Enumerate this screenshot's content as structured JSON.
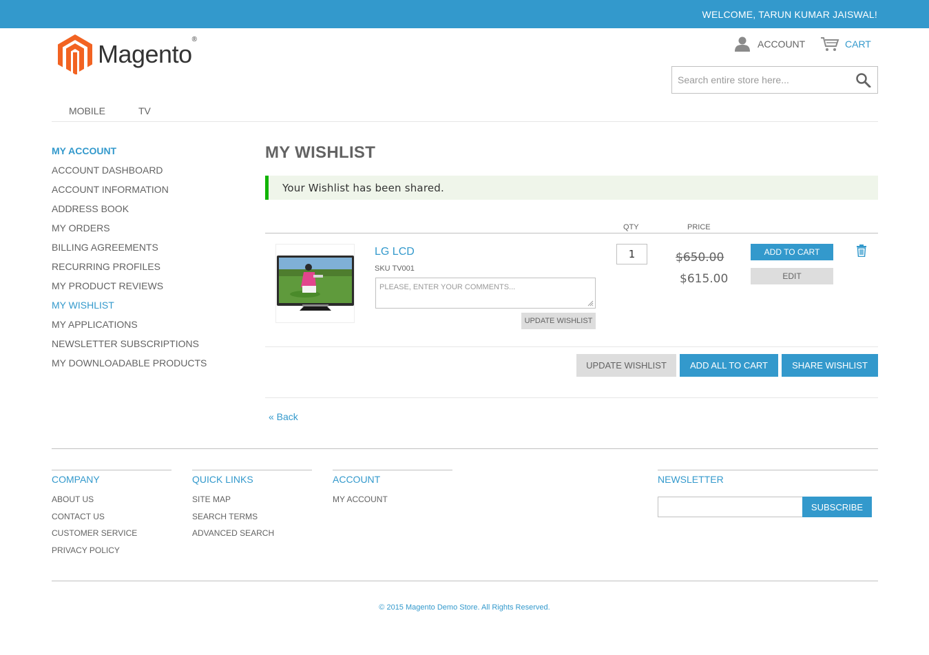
{
  "header": {
    "welcome": "WELCOME, TARUN KUMAR JAISWAL!",
    "logo_text": "Magento",
    "logo_mark": "®",
    "account_label": "ACCOUNT",
    "cart_label": "CART",
    "search_placeholder": "Search entire store here..."
  },
  "nav": {
    "items": [
      "MOBILE",
      "TV"
    ]
  },
  "sidebar": {
    "title": "MY ACCOUNT",
    "items": [
      "ACCOUNT DASHBOARD",
      "ACCOUNT INFORMATION",
      "ADDRESS BOOK",
      "MY ORDERS",
      "BILLING AGREEMENTS",
      "RECURRING PROFILES",
      "MY PRODUCT REVIEWS",
      "MY WISHLIST",
      "MY APPLICATIONS",
      "NEWSLETTER SUBSCRIPTIONS",
      "MY DOWNLOADABLE PRODUCTS"
    ],
    "active": "MY WISHLIST"
  },
  "main": {
    "title": "MY WISHLIST",
    "message": "Your Wishlist has been shared.",
    "columns": {
      "qty": "QTY",
      "price": "PRICE"
    },
    "product": {
      "name": "LG LCD",
      "sku": "SKU TV001",
      "comment_placeholder": "PLEASE, ENTER YOUR COMMENTS...",
      "qty": "1",
      "old_price": "$650.00",
      "new_price": "$615.00",
      "update_label": "UPDATE WISHLIST",
      "add_to_cart_label": "ADD TO CART",
      "edit_label": "EDIT"
    },
    "actions": {
      "update": "UPDATE WISHLIST",
      "add_all": "ADD ALL TO CART",
      "share": "SHARE WISHLIST"
    },
    "back_label": "« Back"
  },
  "footer": {
    "company": {
      "title": "COMPANY",
      "links": [
        "ABOUT US",
        "CONTACT US",
        "CUSTOMER SERVICE",
        "PRIVACY POLICY"
      ]
    },
    "quick_links": {
      "title": "QUICK LINKS",
      "links": [
        "SITE MAP",
        "SEARCH TERMS",
        "ADVANCED SEARCH"
      ]
    },
    "account": {
      "title": "ACCOUNT",
      "links": [
        "MY ACCOUNT"
      ]
    },
    "newsletter": {
      "title": "NEWSLETTER",
      "subscribe_label": "SUBSCRIBE"
    },
    "copyright": "© 2015 Magento Demo Store. All Rights Reserved."
  },
  "colors": {
    "brand_blue": "#3399cc",
    "success_green": "#11b400",
    "logo_orange": "#f26322"
  },
  "icons": [
    "person-icon",
    "cart-icon",
    "search-icon",
    "trash-icon",
    "magento-logo-icon"
  ]
}
